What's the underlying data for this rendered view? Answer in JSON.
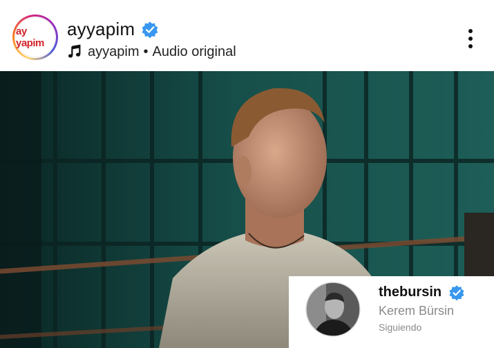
{
  "header": {
    "avatar_text": "ay yapim",
    "username": "ayyapim",
    "audio_owner": "ayyapim",
    "audio_separator": "•",
    "audio_label": "Audio original"
  },
  "profile_card": {
    "handle": "thebursin",
    "full_name": "Kerem Bürsin",
    "status": "Siguiendo"
  },
  "colors": {
    "verified_blue": "#3897f0",
    "logo_red": "#d2232a",
    "video_teal": "#1f5f5a"
  },
  "icons": [
    "verified-icon",
    "music-note-icon",
    "more-options-icon"
  ]
}
